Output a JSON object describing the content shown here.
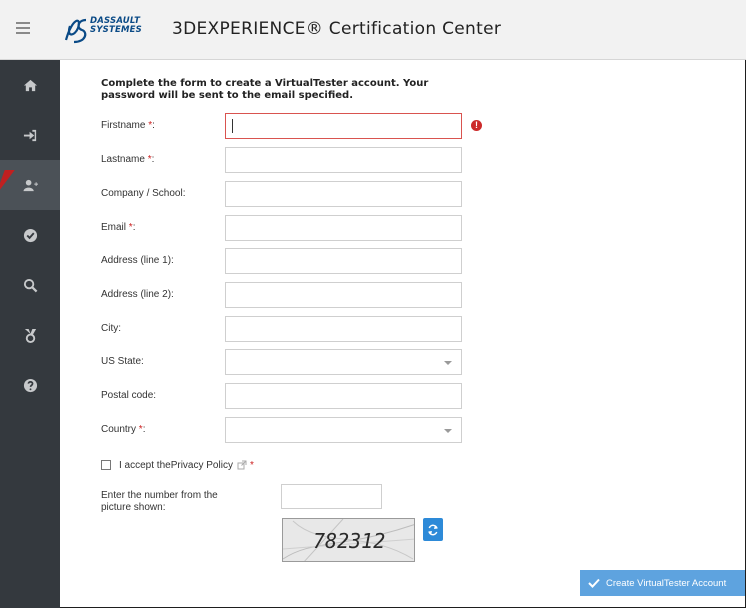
{
  "header": {
    "brand_line1": "DASSAULT",
    "brand_line2": "SYSTEMES",
    "title": "3DEXPERIENCE® Certification Center"
  },
  "sidebar": {
    "items": [
      {
        "icon": "home-icon"
      },
      {
        "icon": "sign-in-icon"
      },
      {
        "icon": "add-user-icon",
        "active": true
      },
      {
        "icon": "check-circle-icon"
      },
      {
        "icon": "search-icon"
      },
      {
        "icon": "certificate-icon"
      },
      {
        "icon": "help-icon"
      }
    ]
  },
  "form": {
    "intro": "Complete the form to create a VirtualTester account. Your password will be sent to the email specified.",
    "required_mark": "*",
    "fields": {
      "firstname": {
        "label": "Firstname ",
        "required": true,
        "value": ""
      },
      "lastname": {
        "label": "Lastname ",
        "required": true,
        "value": ""
      },
      "company": {
        "label": "Company / School:",
        "value": ""
      },
      "email": {
        "label": "Email ",
        "required": true,
        "value": ""
      },
      "address1": {
        "label": "Address (line 1):",
        "value": ""
      },
      "address2": {
        "label": "Address (line 2):",
        "value": ""
      },
      "city": {
        "label": "City:",
        "value": ""
      },
      "us_state": {
        "label": "US State:",
        "value": ""
      },
      "postal_code": {
        "label": "Postal code:",
        "value": ""
      },
      "country": {
        "label": "Country ",
        "required": true,
        "value": ""
      }
    },
    "colon": ":",
    "error_mark": "!",
    "privacy_prefix": "I accept the ",
    "privacy_link": "Privacy Policy",
    "captcha_label": "Enter the number from the picture shown:",
    "captcha_text": "782312",
    "submit_label": "Create VirtualTester Account"
  },
  "colors": {
    "sidebar_bg": "#34393e",
    "accent": "#5ea3df",
    "error": "#cc2a2a"
  }
}
